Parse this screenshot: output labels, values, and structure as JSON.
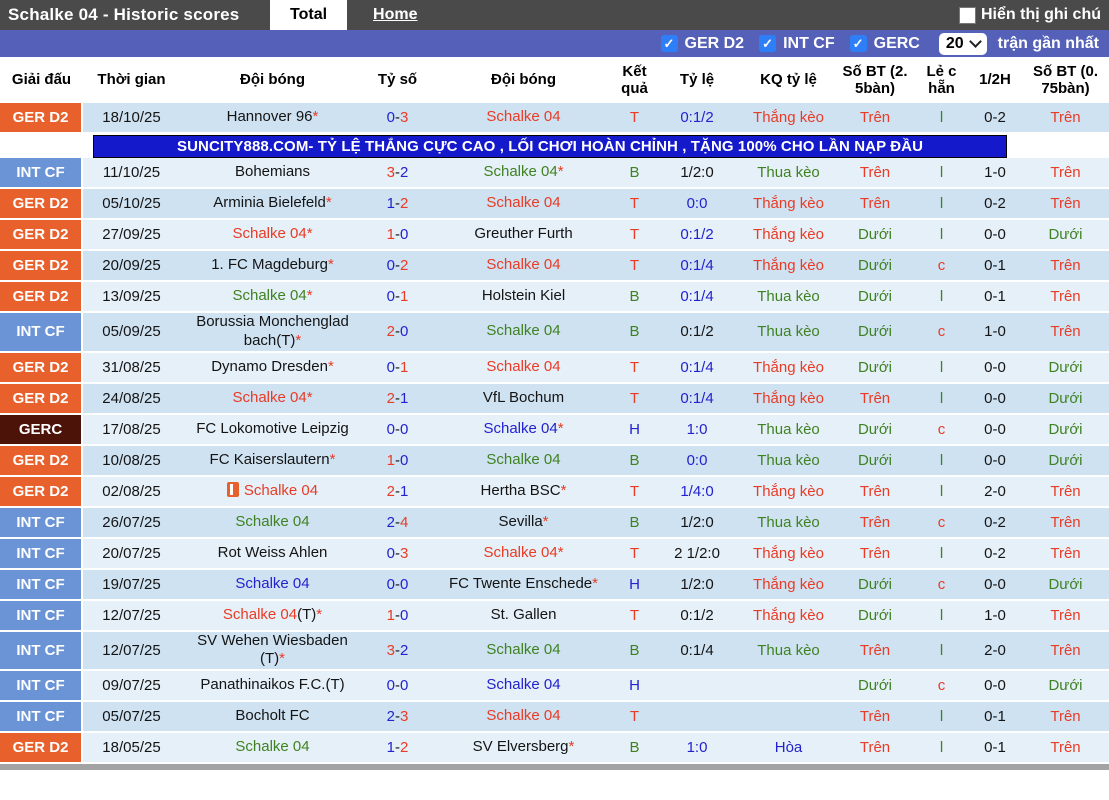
{
  "topbar": {
    "title": "Schalke 04 - Historic scores",
    "tabs": [
      {
        "label": "Total",
        "active": true
      },
      {
        "label": "Home",
        "active": false
      }
    ],
    "note_checkbox_label": "Hiển thị ghi chú",
    "note_checked": false
  },
  "filterbar": {
    "filters": [
      {
        "label": "GER D2",
        "checked": true
      },
      {
        "label": "INT CF",
        "checked": true
      },
      {
        "label": "GERC",
        "checked": true
      }
    ],
    "count_select": "20",
    "suffix": "trận gần nhất"
  },
  "palette": {
    "red": "#e93b25",
    "green": "#3f8222",
    "blue": "#2222cf",
    "black": "#141414"
  },
  "league_colors": {
    "ger2": "#e8602c",
    "intcf": "#6b94d6",
    "gerc": "#4c1309"
  },
  "table": {
    "headers": [
      "Giải đấu",
      "Thời gian",
      "Đội bóng",
      "Tỷ số",
      "Đội bóng",
      "Kết\nquả",
      "Tỷ lệ",
      "KQ tỷ lệ",
      "Số BT (2.\n5bàn)",
      "Lẻ c\nhẵn",
      "1/2H",
      "Số BT (0.\n75bàn)"
    ]
  },
  "ad": {
    "after_row": 0,
    "text": "SUNCITY888.COM- TỶ LỆ THẮNG CỰC CAO , LỐI CHƠI HOÀN CHỈNH , TẶNG 100% CHO LẦN NẠP ĐẦU"
  },
  "rows": [
    {
      "league": "GER D2",
      "league_key": "ger2",
      "date": "18/10/25",
      "home": "Hannover 96",
      "home_star": true,
      "home_color": "black",
      "home_red_card": false,
      "score1": "0",
      "score1_color": "blue",
      "score2": "3",
      "score2_color": "red",
      "away": "Schalke 04",
      "away_star": false,
      "away_color": "red",
      "result": "T",
      "result_color": "red",
      "odds": "0:1/2",
      "odds_color": "blue",
      "odds_result": "Thắng kèo",
      "odds_result_color": "red",
      "over25": "Trên",
      "over25_color": "red",
      "odd_even": "l",
      "odd_even_color": "green",
      "half_score": "0-2",
      "over075": "Trên",
      "over075_color": "red"
    },
    {
      "league": "INT CF",
      "league_key": "intcf",
      "date": "11/10/25",
      "home": "Bohemians",
      "home_star": false,
      "home_color": "black",
      "home_red_card": false,
      "score1": "3",
      "score1_color": "red",
      "score2": "2",
      "score2_color": "blue",
      "away": "Schalke 04",
      "away_star": true,
      "away_color": "green",
      "result": "B",
      "result_color": "green",
      "odds": "1/2:0",
      "odds_color": "black",
      "odds_result": "Thua kèo",
      "odds_result_color": "green",
      "over25": "Trên",
      "over25_color": "red",
      "odd_even": "l",
      "odd_even_color": "green",
      "half_score": "1-0",
      "over075": "Trên",
      "over075_color": "red"
    },
    {
      "league": "GER D2",
      "league_key": "ger2",
      "date": "05/10/25",
      "home": "Arminia Bielefeld",
      "home_star": true,
      "home_color": "black",
      "home_red_card": false,
      "score1": "1",
      "score1_color": "blue",
      "score2": "2",
      "score2_color": "red",
      "away": "Schalke 04",
      "away_star": false,
      "away_color": "red",
      "result": "T",
      "result_color": "red",
      "odds": "0:0",
      "odds_color": "blue",
      "odds_result": "Thắng kèo",
      "odds_result_color": "red",
      "over25": "Trên",
      "over25_color": "red",
      "odd_even": "l",
      "odd_even_color": "green",
      "half_score": "0-2",
      "over075": "Trên",
      "over075_color": "red"
    },
    {
      "league": "GER D2",
      "league_key": "ger2",
      "date": "27/09/25",
      "home": "Schalke 04",
      "home_star": true,
      "home_color": "red",
      "home_red_card": false,
      "score1": "1",
      "score1_color": "red",
      "score2": "0",
      "score2_color": "blue",
      "away": "Greuther Furth",
      "away_star": false,
      "away_color": "black",
      "result": "T",
      "result_color": "red",
      "odds": "0:1/2",
      "odds_color": "blue",
      "odds_result": "Thắng kèo",
      "odds_result_color": "red",
      "over25": "Dưới",
      "over25_color": "green",
      "odd_even": "l",
      "odd_even_color": "green",
      "half_score": "0-0",
      "over075": "Dưới",
      "over075_color": "green"
    },
    {
      "league": "GER D2",
      "league_key": "ger2",
      "date": "20/09/25",
      "home": "1. FC Magdeburg",
      "home_star": true,
      "home_color": "black",
      "home_red_card": false,
      "score1": "0",
      "score1_color": "blue",
      "score2": "2",
      "score2_color": "red",
      "away": "Schalke 04",
      "away_star": false,
      "away_color": "red",
      "result": "T",
      "result_color": "red",
      "odds": "0:1/4",
      "odds_color": "blue",
      "odds_result": "Thắng kèo",
      "odds_result_color": "red",
      "over25": "Dưới",
      "over25_color": "green",
      "odd_even": "c",
      "odd_even_color": "red",
      "half_score": "0-1",
      "over075": "Trên",
      "over075_color": "red"
    },
    {
      "league": "GER D2",
      "league_key": "ger2",
      "date": "13/09/25",
      "home": "Schalke 04",
      "home_star": true,
      "home_color": "green",
      "home_red_card": false,
      "score1": "0",
      "score1_color": "blue",
      "score2": "1",
      "score2_color": "red",
      "away": "Holstein Kiel",
      "away_star": false,
      "away_color": "black",
      "result": "B",
      "result_color": "green",
      "odds": "0:1/4",
      "odds_color": "blue",
      "odds_result": "Thua kèo",
      "odds_result_color": "green",
      "over25": "Dưới",
      "over25_color": "green",
      "odd_even": "l",
      "odd_even_color": "green",
      "half_score": "0-1",
      "over075": "Trên",
      "over075_color": "red"
    },
    {
      "league": "INT CF",
      "league_key": "intcf",
      "date": "05/09/25",
      "home": "Borussia Monchenglad\nbach(T)",
      "home_star": true,
      "home_color": "black",
      "home_red_card": false,
      "score1": "2",
      "score1_color": "red",
      "score2": "0",
      "score2_color": "blue",
      "away": "Schalke 04",
      "away_star": false,
      "away_color": "green",
      "result": "B",
      "result_color": "green",
      "odds": "0:1/2",
      "odds_color": "black",
      "odds_result": "Thua kèo",
      "odds_result_color": "green",
      "over25": "Dưới",
      "over25_color": "green",
      "odd_even": "c",
      "odd_even_color": "red",
      "half_score": "1-0",
      "over075": "Trên",
      "over075_color": "red"
    },
    {
      "league": "GER D2",
      "league_key": "ger2",
      "date": "31/08/25",
      "home": "Dynamo Dresden",
      "home_star": true,
      "home_color": "black",
      "home_red_card": false,
      "score1": "0",
      "score1_color": "blue",
      "score2": "1",
      "score2_color": "red",
      "away": "Schalke 04",
      "away_star": false,
      "away_color": "red",
      "result": "T",
      "result_color": "red",
      "odds": "0:1/4",
      "odds_color": "blue",
      "odds_result": "Thắng kèo",
      "odds_result_color": "red",
      "over25": "Dưới",
      "over25_color": "green",
      "odd_even": "l",
      "odd_even_color": "green",
      "half_score": "0-0",
      "over075": "Dưới",
      "over075_color": "green"
    },
    {
      "league": "GER D2",
      "league_key": "ger2",
      "date": "24/08/25",
      "home": "Schalke 04",
      "home_star": true,
      "home_color": "red",
      "home_red_card": false,
      "score1": "2",
      "score1_color": "red",
      "score2": "1",
      "score2_color": "blue",
      "away": "VfL Bochum",
      "away_star": false,
      "away_color": "black",
      "result": "T",
      "result_color": "red",
      "odds": "0:1/4",
      "odds_color": "blue",
      "odds_result": "Thắng kèo",
      "odds_result_color": "red",
      "over25": "Trên",
      "over25_color": "red",
      "odd_even": "l",
      "odd_even_color": "green",
      "half_score": "0-0",
      "over075": "Dưới",
      "over075_color": "green"
    },
    {
      "league": "GERC",
      "league_key": "gerc",
      "date": "17/08/25",
      "home": "FC Lokomotive Leipzig",
      "home_star": false,
      "home_color": "black",
      "home_red_card": false,
      "score1": "0",
      "score1_color": "blue",
      "score2": "0",
      "score2_color": "blue",
      "away": "Schalke 04",
      "away_star": true,
      "away_color": "blue",
      "result": "H",
      "result_color": "blue",
      "odds": "1:0",
      "odds_color": "blue",
      "odds_result": "Thua kèo",
      "odds_result_color": "green",
      "over25": "Dưới",
      "over25_color": "green",
      "odd_even": "c",
      "odd_even_color": "red",
      "half_score": "0-0",
      "over075": "Dưới",
      "over075_color": "green"
    },
    {
      "league": "GER D2",
      "league_key": "ger2",
      "date": "10/08/25",
      "home": "FC Kaiserslautern",
      "home_star": true,
      "home_color": "black",
      "home_red_card": false,
      "score1": "1",
      "score1_color": "red",
      "score2": "0",
      "score2_color": "blue",
      "away": "Schalke 04",
      "away_star": false,
      "away_color": "green",
      "result": "B",
      "result_color": "green",
      "odds": "0:0",
      "odds_color": "blue",
      "odds_result": "Thua kèo",
      "odds_result_color": "green",
      "over25": "Dưới",
      "over25_color": "green",
      "odd_even": "l",
      "odd_even_color": "green",
      "half_score": "0-0",
      "over075": "Dưới",
      "over075_color": "green"
    },
    {
      "league": "GER D2",
      "league_key": "ger2",
      "date": "02/08/25",
      "home": "Schalke 04",
      "home_star": false,
      "home_color": "red",
      "home_red_card": true,
      "score1": "2",
      "score1_color": "red",
      "score2": "1",
      "score2_color": "blue",
      "away": "Hertha BSC",
      "away_star": true,
      "away_color": "black",
      "result": "T",
      "result_color": "red",
      "odds": "1/4:0",
      "odds_color": "blue",
      "odds_result": "Thắng kèo",
      "odds_result_color": "red",
      "over25": "Trên",
      "over25_color": "red",
      "odd_even": "l",
      "odd_even_color": "green",
      "half_score": "2-0",
      "over075": "Trên",
      "over075_color": "red"
    },
    {
      "league": "INT CF",
      "league_key": "intcf",
      "date": "26/07/25",
      "home": "Schalke 04",
      "home_star": false,
      "home_color": "green",
      "home_red_card": false,
      "score1": "2",
      "score1_color": "blue",
      "score2": "4",
      "score2_color": "red",
      "away": "Sevilla",
      "away_star": true,
      "away_color": "black",
      "result": "B",
      "result_color": "green",
      "odds": "1/2:0",
      "odds_color": "black",
      "odds_result": "Thua kèo",
      "odds_result_color": "green",
      "over25": "Trên",
      "over25_color": "red",
      "odd_even": "c",
      "odd_even_color": "red",
      "half_score": "0-2",
      "over075": "Trên",
      "over075_color": "red"
    },
    {
      "league": "INT CF",
      "league_key": "intcf",
      "date": "20/07/25",
      "home": "Rot Weiss Ahlen",
      "home_star": false,
      "home_color": "black",
      "home_red_card": false,
      "score1": "0",
      "score1_color": "blue",
      "score2": "3",
      "score2_color": "red",
      "away": "Schalke 04",
      "away_star": true,
      "away_color": "red",
      "result": "T",
      "result_color": "red",
      "odds": "2 1/2:0",
      "odds_color": "black",
      "odds_result": "Thắng kèo",
      "odds_result_color": "red",
      "over25": "Trên",
      "over25_color": "red",
      "odd_even": "l",
      "odd_even_color": "green",
      "half_score": "0-2",
      "over075": "Trên",
      "over075_color": "red"
    },
    {
      "league": "INT CF",
      "league_key": "intcf",
      "date": "19/07/25",
      "home": "Schalke 04",
      "home_star": false,
      "home_color": "blue",
      "home_red_card": false,
      "score1": "0",
      "score1_color": "blue",
      "score2": "0",
      "score2_color": "blue",
      "away": "FC Twente Enschede",
      "away_star": true,
      "away_color": "black",
      "result": "H",
      "result_color": "blue",
      "odds": "1/2:0",
      "odds_color": "black",
      "odds_result": "Thắng kèo",
      "odds_result_color": "red",
      "over25": "Dưới",
      "over25_color": "green",
      "odd_even": "c",
      "odd_even_color": "red",
      "half_score": "0-0",
      "over075": "Dưới",
      "over075_color": "green"
    },
    {
      "league": "INT CF",
      "league_key": "intcf",
      "date": "12/07/25",
      "home": "Schalke 04",
      "home_suffix": "(T)",
      "home_star": true,
      "home_color": "red",
      "home_red_card": false,
      "score1": "1",
      "score1_color": "red",
      "score2": "0",
      "score2_color": "blue",
      "away": "St. Gallen",
      "away_star": false,
      "away_color": "black",
      "result": "T",
      "result_color": "red",
      "odds": "0:1/2",
      "odds_color": "black",
      "odds_result": "Thắng kèo",
      "odds_result_color": "red",
      "over25": "Dưới",
      "over25_color": "green",
      "odd_even": "l",
      "odd_even_color": "green",
      "half_score": "1-0",
      "over075": "Trên",
      "over075_color": "red"
    },
    {
      "league": "INT CF",
      "league_key": "intcf",
      "date": "12/07/25",
      "home": "SV Wehen Wiesbaden\n(T)",
      "home_star": true,
      "home_color": "black",
      "home_red_card": false,
      "score1": "3",
      "score1_color": "red",
      "score2": "2",
      "score2_color": "blue",
      "away": "Schalke 04",
      "away_star": false,
      "away_color": "green",
      "result": "B",
      "result_color": "green",
      "odds": "0:1/4",
      "odds_color": "black",
      "odds_result": "Thua kèo",
      "odds_result_color": "green",
      "over25": "Trên",
      "over25_color": "red",
      "odd_even": "l",
      "odd_even_color": "green",
      "half_score": "2-0",
      "over075": "Trên",
      "over075_color": "red"
    },
    {
      "league": "INT CF",
      "league_key": "intcf",
      "date": "09/07/25",
      "home": "Panathinaikos F.C.(T)",
      "home_star": false,
      "home_color": "black",
      "home_red_card": false,
      "score1": "0",
      "score1_color": "blue",
      "score2": "0",
      "score2_color": "blue",
      "away": "Schalke 04",
      "away_star": false,
      "away_color": "blue",
      "result": "H",
      "result_color": "blue",
      "odds": "",
      "odds_color": "black",
      "odds_result": "",
      "odds_result_color": "black",
      "over25": "Dưới",
      "over25_color": "green",
      "odd_even": "c",
      "odd_even_color": "red",
      "half_score": "0-0",
      "over075": "Dưới",
      "over075_color": "green"
    },
    {
      "league": "INT CF",
      "league_key": "intcf",
      "date": "05/07/25",
      "home": "Bocholt FC",
      "home_star": false,
      "home_color": "black",
      "home_red_card": false,
      "score1": "2",
      "score1_color": "blue",
      "score2": "3",
      "score2_color": "red",
      "away": "Schalke 04",
      "away_star": false,
      "away_color": "red",
      "result": "T",
      "result_color": "red",
      "odds": "",
      "odds_color": "black",
      "odds_result": "",
      "odds_result_color": "black",
      "over25": "Trên",
      "over25_color": "red",
      "odd_even": "l",
      "odd_even_color": "green",
      "half_score": "0-1",
      "over075": "Trên",
      "over075_color": "red"
    },
    {
      "league": "GER D2",
      "league_key": "ger2",
      "date": "18/05/25",
      "home": "Schalke 04",
      "home_star": false,
      "home_color": "green",
      "home_red_card": false,
      "score1": "1",
      "score1_color": "blue",
      "score2": "2",
      "score2_color": "red",
      "away": "SV Elversberg",
      "away_star": true,
      "away_color": "black",
      "result": "B",
      "result_color": "green",
      "odds": "1:0",
      "odds_color": "blue",
      "odds_result": "Hòa",
      "odds_result_color": "blue",
      "over25": "Trên",
      "over25_color": "red",
      "odd_even": "l",
      "odd_even_color": "green",
      "half_score": "0-1",
      "over075": "Trên",
      "over075_color": "red"
    }
  ]
}
